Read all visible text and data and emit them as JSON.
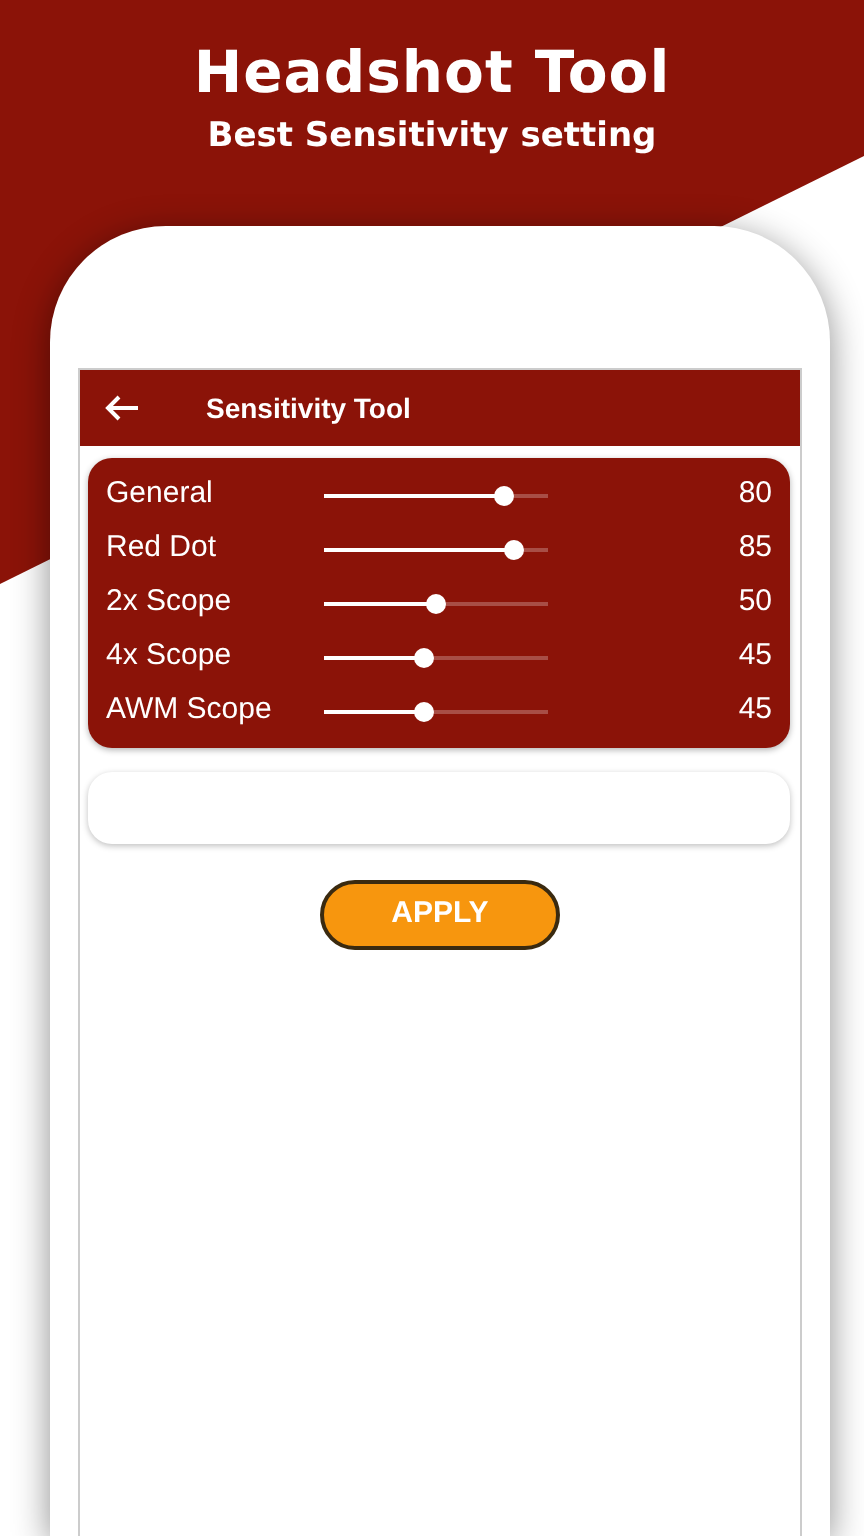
{
  "header": {
    "title": "Headshot Tool",
    "subtitle": "Best Sensitivity setting"
  },
  "app_bar": {
    "title": "Sensitivity Tool"
  },
  "settings": [
    {
      "label": "General",
      "level": 0.8,
      "reading": "80"
    },
    {
      "label": "Red Dot",
      "level": 0.85,
      "reading": "85"
    },
    {
      "label": "2x Scope",
      "level": 0.5,
      "reading": "50"
    },
    {
      "label": "4x Scope",
      "level": 0.45,
      "reading": "45"
    },
    {
      "label": "AWM Scope",
      "level": 0.45,
      "reading": "45"
    }
  ],
  "apply_button": {
    "label": "APPLY"
  }
}
